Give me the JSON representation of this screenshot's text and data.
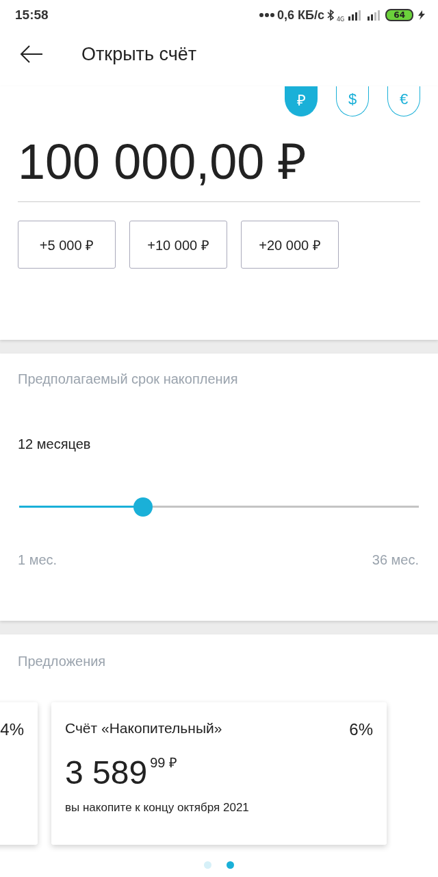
{
  "status_bar": {
    "time": "15:58",
    "speed": "0,6 КБ/с",
    "network": "4G",
    "battery": "64",
    "charging": true
  },
  "header": {
    "title": "Открыть счёт"
  },
  "currencies": [
    {
      "symbol": "₽",
      "selected": true
    },
    {
      "symbol": "$",
      "selected": false
    },
    {
      "symbol": "€",
      "selected": false
    }
  ],
  "amount": {
    "value": "100 000,00 ₽"
  },
  "quick_add": [
    "+5 000 ₽",
    "+10 000 ₽",
    "+20 000 ₽"
  ],
  "term": {
    "label": "Предполагаемый срок накопления",
    "value": "12 месяцев",
    "level": 0.31,
    "min_label": "1 мес.",
    "max_label": "36 мес."
  },
  "offers": {
    "title": "Предложения",
    "cards": [
      {
        "rate": "4%"
      },
      {
        "title": "Счёт «Накопительный»",
        "rate": "6%",
        "amount": "3 589",
        "fraction": "99",
        "currency": "₽",
        "note": "вы накопите к концу октября 2021"
      }
    ]
  },
  "pager": [
    {
      "selected": false
    },
    {
      "selected": true
    }
  ]
}
